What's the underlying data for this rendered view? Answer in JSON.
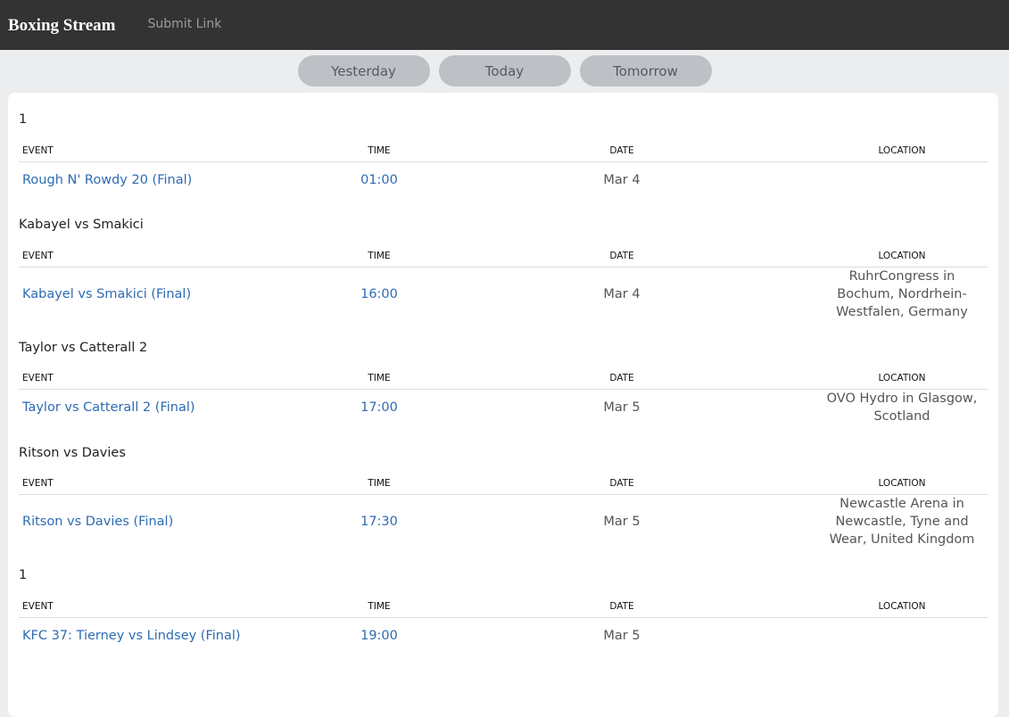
{
  "navbar": {
    "brand": "Boxing Stream",
    "submit_link": "Submit Link"
  },
  "day_tabs": [
    "Yesterday",
    "Today",
    "Tomorrow"
  ],
  "columns": {
    "event": "EVENT",
    "time": "TIME",
    "date": "DATE",
    "location": "LOCATION"
  },
  "groups": [
    {
      "title": "1",
      "rows": [
        {
          "event": "Rough N' Rowdy 20 (Final)",
          "time": "01:00",
          "date": "Mar 4",
          "location": ""
        }
      ]
    },
    {
      "title": "Kabayel vs Smakici",
      "rows": [
        {
          "event": "Kabayel vs Smakici (Final)",
          "time": "16:00",
          "date": "Mar 4",
          "location": "RuhrCongress in Bochum, Nordrhein-Westfalen, Germany"
        }
      ]
    },
    {
      "title": "Taylor vs Catterall 2",
      "rows": [
        {
          "event": "Taylor vs Catterall 2 (Final)",
          "time": "17:00",
          "date": "Mar 5",
          "location": "OVO Hydro in Glasgow, Scotland"
        }
      ]
    },
    {
      "title": "Ritson vs Davies",
      "rows": [
        {
          "event": "Ritson vs Davies (Final)",
          "time": "17:30",
          "date": "Mar 5",
          "location": "Newcastle Arena in Newcastle, Tyne and Wear, United Kingdom"
        }
      ]
    },
    {
      "title": "1",
      "rows": [
        {
          "event": "KFC 37: Tierney vs Lindsey (Final)",
          "time": "19:00",
          "date": "Mar 5",
          "location": ""
        }
      ]
    }
  ],
  "colors": {
    "navbar_bg": "#333333",
    "link": "#2d6bb3",
    "tab_bg": "#bdc1c6",
    "page_bg": "#ebedef"
  }
}
